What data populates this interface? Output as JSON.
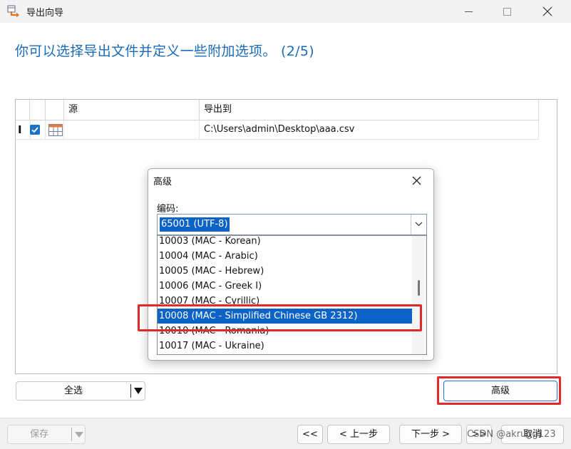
{
  "window": {
    "title": "导出向导",
    "icon": "export-wizard-icon"
  },
  "heading": "你可以选择导出文件并定义一些附加选项。 (2/5)",
  "grid": {
    "columns": [
      "源",
      "导出到"
    ],
    "rows": [
      {
        "checked": true,
        "source": "",
        "target": "C:\\Users\\admin\\Desktop\\aaa.csv"
      }
    ]
  },
  "buttons": {
    "select_all": "全选",
    "advanced": "高级",
    "save": "保存",
    "first": "<<",
    "prev": "< 上一步",
    "next": "下一步 >",
    "last": ">>",
    "cancel": "取消"
  },
  "dialog": {
    "title": "高级",
    "encoding_label": "编码:",
    "encoding_value": "65001 (UTF-8)",
    "options": [
      "10003 (MAC - Korean)",
      "10004 (MAC - Arabic)",
      "10005 (MAC - Hebrew)",
      "10006 (MAC - Greek I)",
      "10007 (MAC - Cyrillic)",
      "10008 (MAC - Simplified Chinese GB 2312)",
      "10010 (MAC - Romania)",
      "10017 (MAC - Ukraine)"
    ],
    "selected_option": "10008 (MAC - Simplified Chinese GB 2312)"
  },
  "watermark": "CSDN @akrugg123",
  "colors": {
    "accent": "#0b63c7",
    "heading": "#1c6bb8",
    "highlight_box": "#e02a2a"
  }
}
